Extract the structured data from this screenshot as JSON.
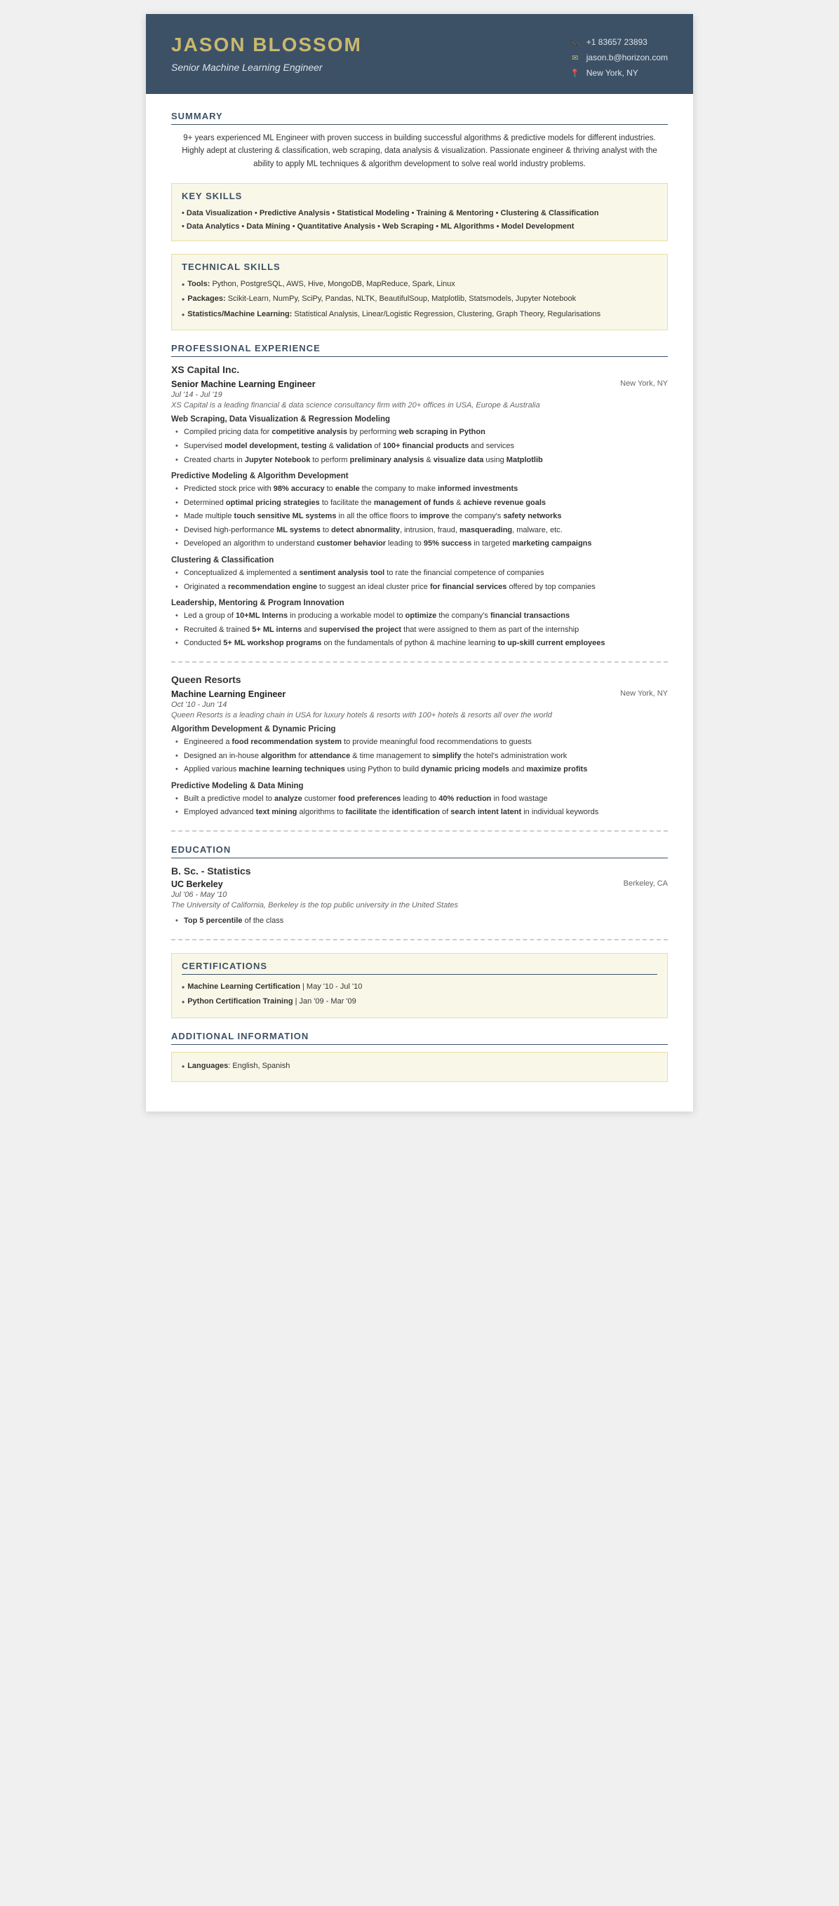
{
  "header": {
    "name": "JASON BLOSSOM",
    "title": "Senior Machine Learning Engineer",
    "phone": "+1 83657 23893",
    "email": "jason.b@horizon.com",
    "location": "New York, NY"
  },
  "summary": {
    "title": "SUMMARY",
    "text": "9+ years experienced ML Engineer with proven success in building successful algorithms & predictive models for different industries. Highly adept at clustering & classification, web scraping, data analysis & visualization. Passionate engineer & thriving analyst with the ability to apply ML techniques & algorithm development to solve real world industry problems."
  },
  "keySkills": {
    "title": "KEY SKILLS",
    "lines": [
      "• Data Visualization • Predictive Analysis • Statistical Modeling • Training & Mentoring • Clustering & Classification",
      "• Data Analytics • Data Mining • Quantitative Analysis • Web Scraping • ML Algorithms • Model Development"
    ]
  },
  "technicalSkills": {
    "title": "TECHNICAL SKILLS",
    "items": [
      {
        "label": "Tools:",
        "value": "Python, PostgreSQL, AWS, Hive, MongoDB, MapReduce, Spark, Linux"
      },
      {
        "label": "Packages:",
        "value": "Scikit-Learn, NumPy, SciPy, Pandas, NLTK, BeautifulSoup, Matplotlib, Statsmodels, Jupyter Notebook"
      },
      {
        "label": "Statistics/Machine Learning:",
        "value": "Statistical Analysis, Linear/Logistic Regression, Clustering, Graph Theory, Regularisations"
      }
    ]
  },
  "experience": {
    "title": "PROFESSIONAL EXPERIENCE",
    "jobs": [
      {
        "company": "XS Capital Inc.",
        "title": "Senior Machine Learning Engineer",
        "location": "New York, NY",
        "dates": "Jul '14 - Jul '19",
        "companyDesc": "XS Capital is a leading financial & data science consultancy firm with 20+ offices in USA, Europe & Australia",
        "subsections": [
          {
            "title": "Web Scraping, Data Visualization & Regression Modeling",
            "bullets": [
              "Compiled pricing data for <b>competitive analysis</b> by performing <b>web scraping in Python</b>",
              "Supervised <b>model development, testing</b> & <b>validation</b> of <b>100+ financial products</b> and services",
              "Created charts in <b>Jupyter Notebook</b> to perform <b>preliminary analysis</b> & <b>visualize data</b> using <b>Matplotlib</b>"
            ]
          },
          {
            "title": "Predictive Modeling & Algorithm Development",
            "bullets": [
              "Predicted stock price with <b>98% accuracy</b> to <b>enable</b> the company to make <b>informed investments</b>",
              "Determined <b>optimal pricing strategies</b> to facilitate the <b>management of funds</b> & <b>achieve revenue goals</b>",
              "Made multiple <b>touch sensitive ML systems</b> in all the office floors to <b>improve</b> the company's <b>safety networks</b>",
              "Devised high-performance <b>ML systems</b> to <b>detect abnormality</b>, intrusion, fraud, <b>masquerading</b>, malware, etc.",
              "Developed an algorithm to understand <b>customer behavior</b> leading to <b>95% success</b> in targeted <b>marketing campaigns</b>"
            ]
          },
          {
            "title": "Clustering & Classification",
            "bullets": [
              "Conceptualized & implemented a <b>sentiment analysis tool</b> to rate the financial competence of companies",
              "Originated a <b>recommendation engine</b> to suggest an ideal cluster price <b>for financial services</b> offered by top companies"
            ]
          },
          {
            "title": "Leadership, Mentoring & Program Innovation",
            "bullets": [
              "Led a group of <b>10+ML Interns</b> in producing a workable model to <b>optimize</b> the company's <b>financial transactions</b>",
              "Recruited & trained <b>5+ ML interns</b> and <b>supervised the project</b> that were assigned to them as part of the internship",
              "Conducted <b>5+ ML workshop programs</b> on the fundamentals of python & machine learning <b>to up-skill current employees</b>"
            ]
          }
        ]
      },
      {
        "company": "Queen Resorts",
        "title": "Machine Learning Engineer",
        "location": "New York, NY",
        "dates": "Oct '10 - Jun '14",
        "companyDesc": "Queen Resorts is a leading chain in USA for luxury hotels & resorts with 100+ hotels & resorts all over the world",
        "subsections": [
          {
            "title": "Algorithm Development & Dynamic Pricing",
            "bullets": [
              "Engineered a <b>food recommendation system</b> to provide meaningful food recommendations to guests",
              "Designed an in-house <b>algorithm</b> for <b>attendance</b> & time management to <b>simplify</b> the hotel's administration work",
              "Applied various <b>machine learning techniques</b> using Python to build <b>dynamic pricing models</b> and <b>maximize profits</b>"
            ]
          },
          {
            "title": "Predictive Modeling & Data Mining",
            "bullets": [
              "Built a predictive model to <b>analyze</b> customer <b>food preferences</b> leading to <b>40% reduction</b> in food wastage",
              "Employed advanced <b>text mining</b> algorithms to <b>facilitate</b> the <b>identification</b> of <b>search intent latent</b> in individual keywords"
            ]
          }
        ]
      }
    ]
  },
  "education": {
    "title": "EDUCATION",
    "entries": [
      {
        "degree": "B. Sc. - Statistics",
        "institution": "UC Berkeley",
        "location": "Berkeley, CA",
        "dates": "Jul '06 - May '10",
        "desc": "The University of California, Berkeley is the top public university in the United States",
        "bullets": [
          "<b>Top 5 percentile</b> of the class"
        ]
      }
    ]
  },
  "certifications": {
    "title": "CERTIFICATIONS",
    "items": [
      {
        "name": "Machine Learning Certification",
        "dates": "| May '10 - Jul '10"
      },
      {
        "name": "Python Certification Training",
        "dates": "| Jan '09 - Mar '09"
      }
    ]
  },
  "additionalInfo": {
    "title": "ADDITIONAL INFORMATION",
    "items": [
      {
        "label": "Languages",
        "value": "English, Spanish"
      }
    ]
  }
}
